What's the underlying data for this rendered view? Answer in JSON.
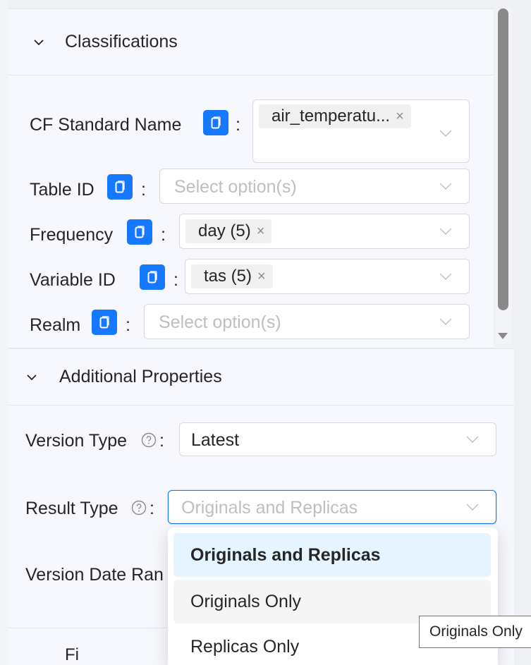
{
  "classifications": {
    "title": "Classifications",
    "fields": [
      {
        "label": "CF Standard Name",
        "tags": [
          "air_temperatu..."
        ],
        "placeholder": ""
      },
      {
        "label": "Table ID",
        "tags": [],
        "placeholder": "Select option(s)"
      },
      {
        "label": "Frequency",
        "tags": [
          "day (5)"
        ],
        "placeholder": ""
      },
      {
        "label": "Variable ID",
        "tags": [
          "tas (5)"
        ],
        "placeholder": ""
      },
      {
        "label": "Realm",
        "tags": [],
        "placeholder": "Select option(s)"
      }
    ],
    "colon": ":",
    "tag_close": "×"
  },
  "additional": {
    "title": "Additional Properties",
    "version_type": {
      "label": "Version Type",
      "colon": ":",
      "value": "Latest"
    },
    "result_type": {
      "label": "Result Type",
      "colon": ":",
      "placeholder": "Originals and Replicas"
    },
    "version_date_range": {
      "label": "Version Date Ran"
    }
  },
  "filters_partial": "Fi",
  "dropdown": {
    "options": [
      {
        "label": "Originals and Replicas",
        "state": "selected"
      },
      {
        "label": "Originals Only",
        "state": "hover"
      },
      {
        "label": "Replicas Only",
        "state": ""
      }
    ]
  },
  "tooltip": "Originals Only",
  "colors": {
    "accent": "#1677ff",
    "panel": "#f6f8fd",
    "selected_option": "#e6f4ff"
  },
  "icons": [
    "chevron-down-icon",
    "copy-icon",
    "question-circle-icon",
    "close-icon"
  ]
}
